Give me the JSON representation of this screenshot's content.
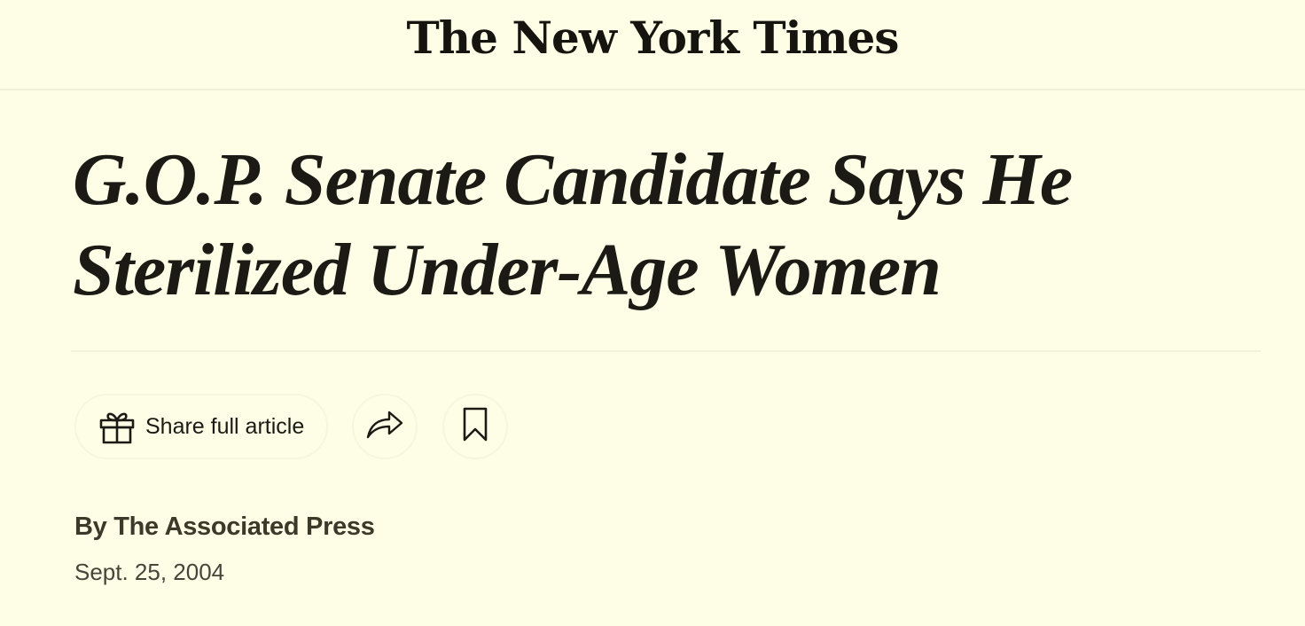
{
  "masthead": {
    "logo_text": "The New York Times"
  },
  "article": {
    "headline": "G.O.P. Senate Candidate Says He Sterilized Under-Age Women",
    "byline": "By The Associated Press",
    "date": "Sept. 25, 2004"
  },
  "toolbar": {
    "share_full_label": "Share full article",
    "gift_icon": "gift-icon",
    "share_icon": "share-arrow-icon",
    "save_icon": "bookmark-icon"
  },
  "colors": {
    "background": "#fefee6",
    "text": "#1b1a15",
    "byline": "#3c382a"
  }
}
